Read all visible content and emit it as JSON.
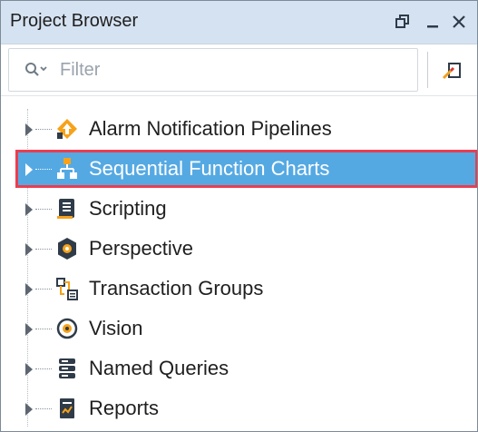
{
  "window": {
    "title": "Project Browser",
    "controls": [
      "restore-icon",
      "minimize-icon",
      "close-icon"
    ]
  },
  "search": {
    "placeholder": "Filter",
    "value": ""
  },
  "toolbar": {
    "edit_icon": "edit-icon"
  },
  "tree": {
    "items": [
      {
        "label": "Alarm Notification Pipelines",
        "icon": "alarm-pipeline-icon",
        "selected": false
      },
      {
        "label": "Sequential Function Charts",
        "icon": "sfc-icon",
        "selected": true
      },
      {
        "label": "Scripting",
        "icon": "scripting-icon",
        "selected": false
      },
      {
        "label": "Perspective",
        "icon": "perspective-icon",
        "selected": false
      },
      {
        "label": "Transaction Groups",
        "icon": "transaction-groups-icon",
        "selected": false
      },
      {
        "label": "Vision",
        "icon": "vision-icon",
        "selected": false
      },
      {
        "label": "Named Queries",
        "icon": "named-queries-icon",
        "selected": false
      },
      {
        "label": "Reports",
        "icon": "reports-icon",
        "selected": false
      }
    ]
  },
  "colors": {
    "selection": "#55a9e3",
    "selection_border": "#ea3d4f",
    "titlebar": "#d5e2f1"
  }
}
